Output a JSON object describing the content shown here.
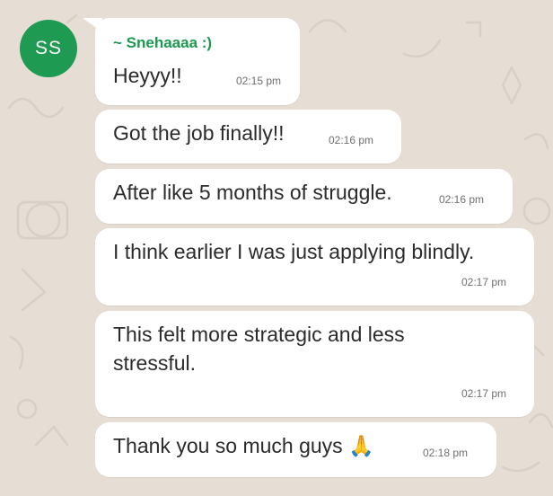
{
  "chat": {
    "avatar_initials": "SS",
    "avatar_color": "#1f9a52",
    "sender_name": "~ Snehaaaa :)",
    "sender_color": "#1a9a4e",
    "messages": [
      {
        "text": "Heyyy!!",
        "time": "02:15 pm"
      },
      {
        "text": "Got the job finally!!",
        "time": "02:16 pm"
      },
      {
        "text": "After like 5 months of struggle.",
        "time": "02:16 pm"
      },
      {
        "text": "I think earlier I was just applying blindly.",
        "time": "02:17 pm"
      },
      {
        "line1": "This felt more strategic and less",
        "line2": "stressful.",
        "time": "02:17 pm"
      },
      {
        "text": "Thank you so much guys 🙏",
        "time": "02:18 pm"
      }
    ]
  }
}
